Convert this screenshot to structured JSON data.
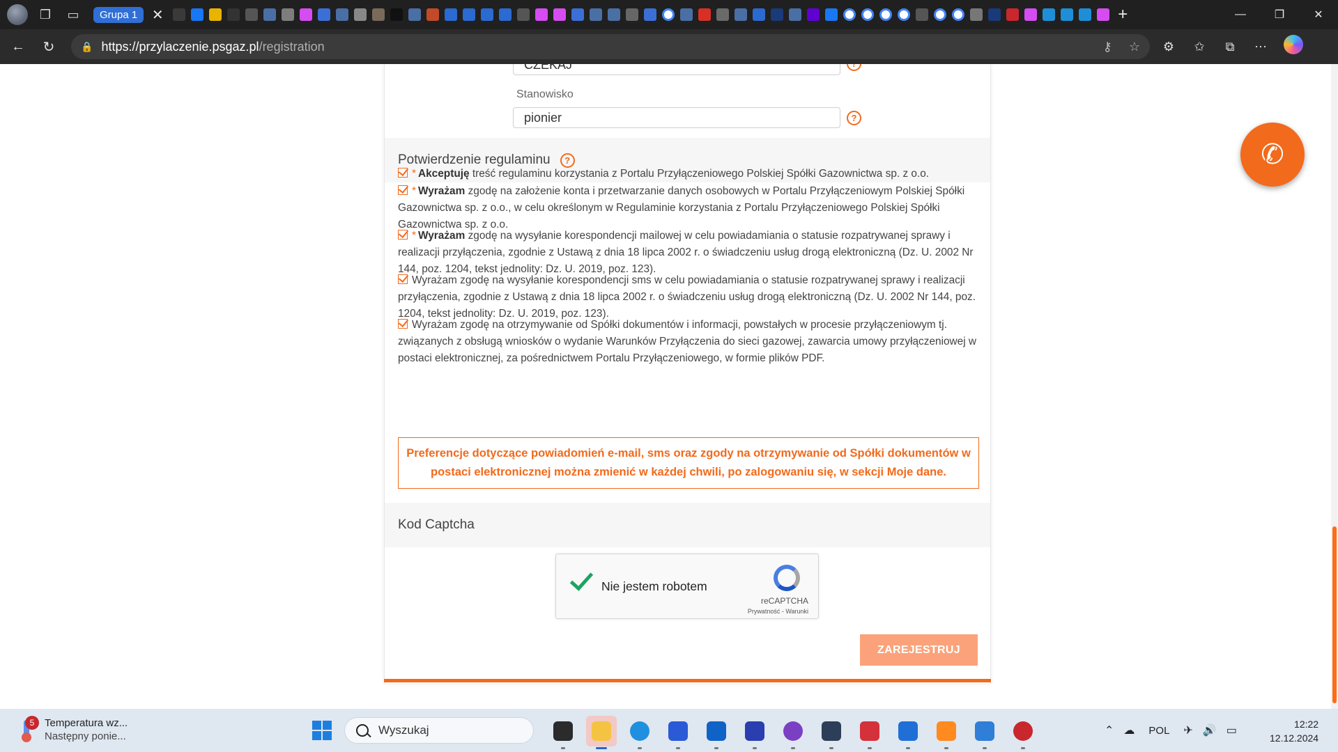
{
  "browser": {
    "tab_group_label": "Grupa 1",
    "favicon_names": [
      "camera-icon",
      "facebook-icon",
      "p-icon",
      "infinity-icon",
      "grid-icon",
      "search-icon",
      "stamp-icon",
      "multicolor-icon",
      "b-icon",
      "search-icon",
      "card-icon",
      "p-icon",
      "x-icon",
      "search-icon",
      "feather-icon",
      "at-icon",
      "mail-icon",
      "mail-icon",
      "image-icon",
      "building-icon",
      "multicolor-icon",
      "multicolor-icon",
      "b-icon",
      "search-icon",
      "search-icon",
      "camera-icon",
      "b-icon",
      "google-icon",
      "search-icon",
      "gmail-icon",
      "feather-icon",
      "search-icon",
      "at-icon",
      "aol-icon",
      "search-icon",
      "yahoo-icon",
      "facebook-icon",
      "google-icon",
      "google-icon",
      "google-icon",
      "google-icon",
      "camera-icon",
      "google-icon",
      "google-icon",
      "gear-icon",
      "aol-icon",
      "pdf-icon",
      "multicolor-icon",
      "gk-icon",
      "gk-icon",
      "gk-icon",
      "multicolor-icon"
    ],
    "url_host": "https://przylaczenie.psgaz.pl",
    "url_path": "/registration"
  },
  "form": {
    "hidden_field_value": "CZEKAJ",
    "position_label": "Stanowisko",
    "position_value": "pionier",
    "help_glyph": "?"
  },
  "terms": {
    "heading": "Potwierdzenie regulaminu",
    "consents": [
      {
        "required": true,
        "star": "*",
        "bold": "Akceptuję",
        "text": " treść regulaminu korzystania z Portalu Przyłączeniowego Polskiej Spółki Gazownictwa sp. z o.o."
      },
      {
        "required": true,
        "star": "*",
        "bold": "Wyrażam",
        "text": " zgodę na założenie konta i przetwarzanie danych osobowych w Portalu Przyłączeniowym Polskiej Spółki Gazownictwa sp. z o.o., w celu określonym w Regulaminie korzystania z Portalu Przyłączeniowego Polskiej Spółki Gazownictwa sp. z o.o."
      },
      {
        "required": true,
        "star": "*",
        "bold": "Wyrażam",
        "text": " zgodę na wysyłanie korespondencji mailowej w celu powiadamiania o statusie rozpatrywanej sprawy i realizacji przyłączenia, zgodnie z Ustawą z dnia 18 lipca 2002 r. o świadczeniu usług drogą elektroniczną (Dz. U. 2002 Nr 144, poz. 1204, tekst jednolity: Dz. U. 2019, poz. 123)."
      },
      {
        "required": false,
        "star": "",
        "bold": "",
        "text": "Wyrażam zgodę na wysyłanie korespondencji sms w celu powiadamiania o statusie rozpatrywanej sprawy i realizacji przyłączenia, zgodnie z Ustawą z dnia 18 lipca 2002 r. o świadczeniu usług drogą elektroniczną (Dz. U. 2002 Nr 144, poz. 1204, tekst jednolity: Dz. U. 2019, poz. 123)."
      },
      {
        "required": false,
        "star": "",
        "bold": "",
        "text": "Wyrażam zgodę na otrzymywanie od Spółki dokumentów i informacji, powstałych w procesie przyłączeniowym tj. związanych z obsługą wniosków o wydanie Warunków Przyłączenia do sieci gazowej, zawarcia umowy przyłączeniowej w postaci elektronicznej, za pośrednictwem Portalu Przyłączeniowego, w formie plików PDF."
      }
    ],
    "notice": "Preferencje dotyczące powiadomień e-mail, sms oraz zgody na otrzymywanie od Spółki dokumentów w postaci elektronicznej można zmienić w każdej chwili, po zalogowaniu się, w sekcji Moje dane."
  },
  "captcha": {
    "heading": "Kod Captcha",
    "label": "Nie jestem robotem",
    "checked": true,
    "brand": "reCAPTCHA",
    "links": "Prywatność - Warunki"
  },
  "actions": {
    "register_label": "ZAREJESTRUJ"
  },
  "colors": {
    "accent": "#f26a1b",
    "button": "#fba27a",
    "captcha_check": "#1ea362"
  },
  "taskbar": {
    "weather_badge": "5",
    "weather_title": "Temperatura wz...",
    "weather_sub": "Następny ponie...",
    "search_placeholder": "Wyszukaj",
    "apps": [
      "terminal-icon",
      "file-explorer-icon",
      "edge-icon",
      "store-icon",
      "outlook-icon",
      "save-icon",
      "github-icon",
      "box-icon",
      "camera-raw-icon",
      "help-icon",
      "media-player-icon",
      "notepad-icon",
      "app-icon"
    ],
    "language": "POL",
    "time": "12:22",
    "date": "12.12.2024"
  }
}
